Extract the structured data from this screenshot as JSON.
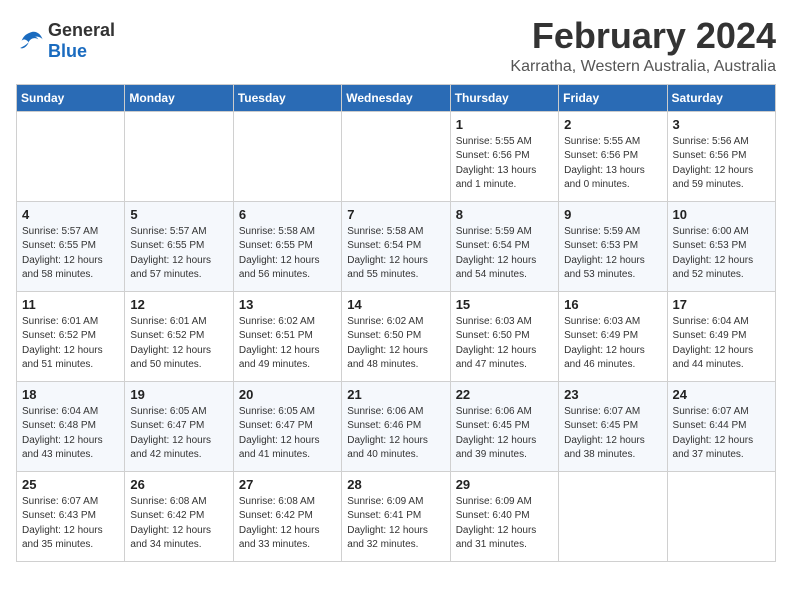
{
  "logo": {
    "general": "General",
    "blue": "Blue"
  },
  "title": "February 2024",
  "subtitle": "Karratha, Western Australia, Australia",
  "days_of_week": [
    "Sunday",
    "Monday",
    "Tuesday",
    "Wednesday",
    "Thursday",
    "Friday",
    "Saturday"
  ],
  "weeks": [
    [
      {
        "day": "",
        "info": ""
      },
      {
        "day": "",
        "info": ""
      },
      {
        "day": "",
        "info": ""
      },
      {
        "day": "",
        "info": ""
      },
      {
        "day": "1",
        "info": "Sunrise: 5:55 AM\nSunset: 6:56 PM\nDaylight: 13 hours\nand 1 minute."
      },
      {
        "day": "2",
        "info": "Sunrise: 5:55 AM\nSunset: 6:56 PM\nDaylight: 13 hours\nand 0 minutes."
      },
      {
        "day": "3",
        "info": "Sunrise: 5:56 AM\nSunset: 6:56 PM\nDaylight: 12 hours\nand 59 minutes."
      }
    ],
    [
      {
        "day": "4",
        "info": "Sunrise: 5:57 AM\nSunset: 6:55 PM\nDaylight: 12 hours\nand 58 minutes."
      },
      {
        "day": "5",
        "info": "Sunrise: 5:57 AM\nSunset: 6:55 PM\nDaylight: 12 hours\nand 57 minutes."
      },
      {
        "day": "6",
        "info": "Sunrise: 5:58 AM\nSunset: 6:55 PM\nDaylight: 12 hours\nand 56 minutes."
      },
      {
        "day": "7",
        "info": "Sunrise: 5:58 AM\nSunset: 6:54 PM\nDaylight: 12 hours\nand 55 minutes."
      },
      {
        "day": "8",
        "info": "Sunrise: 5:59 AM\nSunset: 6:54 PM\nDaylight: 12 hours\nand 54 minutes."
      },
      {
        "day": "9",
        "info": "Sunrise: 5:59 AM\nSunset: 6:53 PM\nDaylight: 12 hours\nand 53 minutes."
      },
      {
        "day": "10",
        "info": "Sunrise: 6:00 AM\nSunset: 6:53 PM\nDaylight: 12 hours\nand 52 minutes."
      }
    ],
    [
      {
        "day": "11",
        "info": "Sunrise: 6:01 AM\nSunset: 6:52 PM\nDaylight: 12 hours\nand 51 minutes."
      },
      {
        "day": "12",
        "info": "Sunrise: 6:01 AM\nSunset: 6:52 PM\nDaylight: 12 hours\nand 50 minutes."
      },
      {
        "day": "13",
        "info": "Sunrise: 6:02 AM\nSunset: 6:51 PM\nDaylight: 12 hours\nand 49 minutes."
      },
      {
        "day": "14",
        "info": "Sunrise: 6:02 AM\nSunset: 6:50 PM\nDaylight: 12 hours\nand 48 minutes."
      },
      {
        "day": "15",
        "info": "Sunrise: 6:03 AM\nSunset: 6:50 PM\nDaylight: 12 hours\nand 47 minutes."
      },
      {
        "day": "16",
        "info": "Sunrise: 6:03 AM\nSunset: 6:49 PM\nDaylight: 12 hours\nand 46 minutes."
      },
      {
        "day": "17",
        "info": "Sunrise: 6:04 AM\nSunset: 6:49 PM\nDaylight: 12 hours\nand 44 minutes."
      }
    ],
    [
      {
        "day": "18",
        "info": "Sunrise: 6:04 AM\nSunset: 6:48 PM\nDaylight: 12 hours\nand 43 minutes."
      },
      {
        "day": "19",
        "info": "Sunrise: 6:05 AM\nSunset: 6:47 PM\nDaylight: 12 hours\nand 42 minutes."
      },
      {
        "day": "20",
        "info": "Sunrise: 6:05 AM\nSunset: 6:47 PM\nDaylight: 12 hours\nand 41 minutes."
      },
      {
        "day": "21",
        "info": "Sunrise: 6:06 AM\nSunset: 6:46 PM\nDaylight: 12 hours\nand 40 minutes."
      },
      {
        "day": "22",
        "info": "Sunrise: 6:06 AM\nSunset: 6:45 PM\nDaylight: 12 hours\nand 39 minutes."
      },
      {
        "day": "23",
        "info": "Sunrise: 6:07 AM\nSunset: 6:45 PM\nDaylight: 12 hours\nand 38 minutes."
      },
      {
        "day": "24",
        "info": "Sunrise: 6:07 AM\nSunset: 6:44 PM\nDaylight: 12 hours\nand 37 minutes."
      }
    ],
    [
      {
        "day": "25",
        "info": "Sunrise: 6:07 AM\nSunset: 6:43 PM\nDaylight: 12 hours\nand 35 minutes."
      },
      {
        "day": "26",
        "info": "Sunrise: 6:08 AM\nSunset: 6:42 PM\nDaylight: 12 hours\nand 34 minutes."
      },
      {
        "day": "27",
        "info": "Sunrise: 6:08 AM\nSunset: 6:42 PM\nDaylight: 12 hours\nand 33 minutes."
      },
      {
        "day": "28",
        "info": "Sunrise: 6:09 AM\nSunset: 6:41 PM\nDaylight: 12 hours\nand 32 minutes."
      },
      {
        "day": "29",
        "info": "Sunrise: 6:09 AM\nSunset: 6:40 PM\nDaylight: 12 hours\nand 31 minutes."
      },
      {
        "day": "",
        "info": ""
      },
      {
        "day": "",
        "info": ""
      }
    ]
  ]
}
